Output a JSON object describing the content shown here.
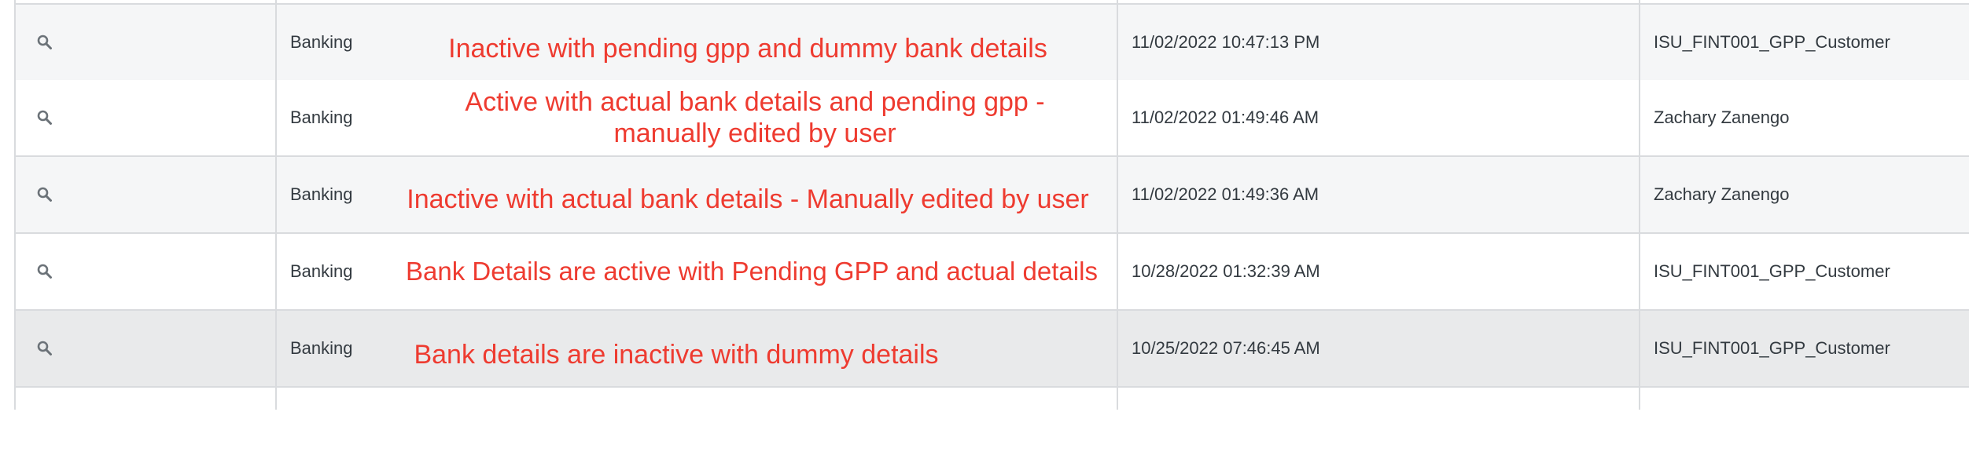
{
  "colors": {
    "annotation": "#ee3b30",
    "row_alt": "#f5f6f7",
    "row_highlight": "#e9eaeb",
    "border": "#d9dbde",
    "text": "#333a40"
  },
  "rows": [
    {
      "icon": "magnifier-icon",
      "type": "Banking",
      "note": "Inactive with pending gpp and dummy bank details",
      "datetime": "11/02/2022 10:47:13 PM",
      "user": "ISU_FINT001_GPP_Customer"
    },
    {
      "icon": "magnifier-icon",
      "type": "Banking",
      "note": "Active with actual bank details and pending gpp - manually edited by user",
      "datetime": "11/02/2022 01:49:46 AM",
      "user": "Zachary Zanengo"
    },
    {
      "icon": "magnifier-icon",
      "type": "Banking",
      "note": "Inactive with actual bank details - Manually edited by user",
      "datetime": "11/02/2022 01:49:36 AM",
      "user": "Zachary Zanengo"
    },
    {
      "icon": "magnifier-icon",
      "type": "Banking",
      "note": "Bank Details are active with Pending GPP and actual details",
      "datetime": "10/28/2022 01:32:39 AM",
      "user": "ISU_FINT001_GPP_Customer"
    },
    {
      "icon": "magnifier-icon",
      "type": "Banking",
      "note": "Bank details are inactive with dummy details",
      "datetime": "10/25/2022 07:46:45 AM",
      "user": "ISU_FINT001_GPP_Customer"
    }
  ]
}
